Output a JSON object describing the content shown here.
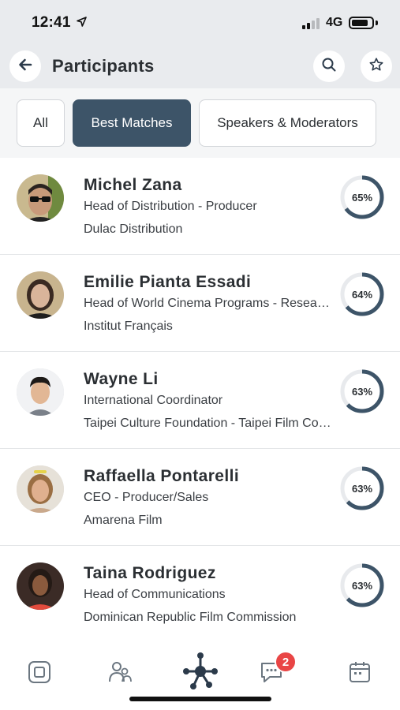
{
  "status_bar": {
    "time": "12:41",
    "network": "4G",
    "signal_bars_active": 2,
    "signal_bars_total": 4,
    "battery_level": 0.85
  },
  "header": {
    "title": "Participants",
    "back_icon": "arrow-left-icon",
    "search_icon": "search-icon",
    "favorite_icon": "star-icon"
  },
  "tabs": {
    "all": "All",
    "best": "Best Matches",
    "speakers": "Speakers & Moderators",
    "active": "best"
  },
  "colors": {
    "accent": "#3d5468",
    "header_bg": "#e9ebee",
    "ring_track": "#e8eaed",
    "badge": "#e94545"
  },
  "participants": [
    {
      "name": "Michel Zana",
      "role": "Head of Distribution - Producer",
      "organization": "Dulac Distribution",
      "match_label": "65%",
      "match": 65
    },
    {
      "name": "Emilie Pianta Essadi",
      "role": "Head of World Cinema Programs - Research",
      "organization": "Institut Français",
      "match_label": "64%",
      "match": 64
    },
    {
      "name": "Wayne Li",
      "role": "International Coordinator",
      "organization": "Taipei Culture Foundation - Taipei Film Commission",
      "match_label": "63%",
      "match": 63
    },
    {
      "name": "Raffaella Pontarelli",
      "role": "CEO - Producer/Sales",
      "organization": "Amarena Film",
      "match_label": "63%",
      "match": 63
    },
    {
      "name": "Taina Rodriguez",
      "role": "Head of Communications",
      "organization": "Dominican Republic Film Commission",
      "match_label": "63%",
      "match": 63
    }
  ],
  "bottom_nav": {
    "items": [
      "home-icon",
      "people-icon",
      "network-icon",
      "chat-icon",
      "calendar-icon"
    ],
    "chat_badge": "2"
  }
}
